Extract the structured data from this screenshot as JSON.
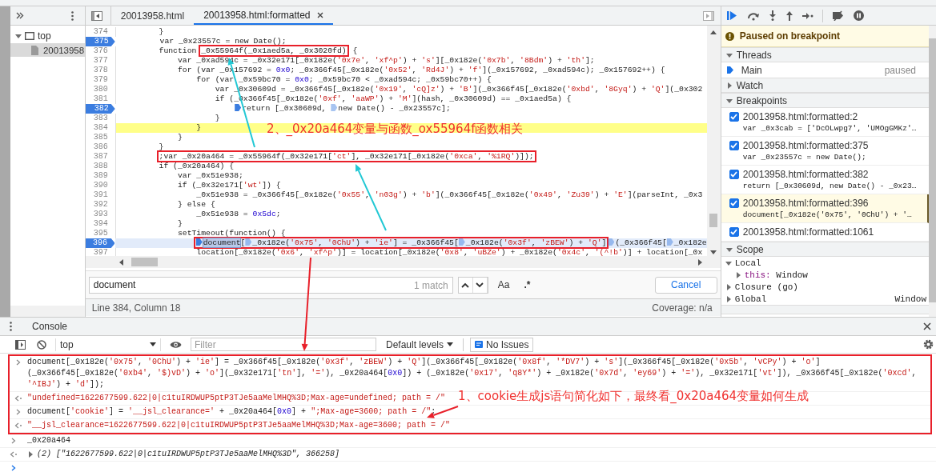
{
  "navigator": {
    "tree": [
      {
        "label": "top",
        "expanded": true,
        "children": [
          {
            "label": "20013958",
            "selected": true
          }
        ]
      }
    ]
  },
  "editor": {
    "tabs": [
      {
        "label": "20013958.html",
        "selected": false,
        "closable": false
      },
      {
        "label": "20013958.html:formatted",
        "selected": true,
        "closable": true
      }
    ],
    "lines": [
      {
        "number": "374",
        "breakpoint": false,
        "kind": "plain",
        "text": "        }"
      },
      {
        "number": "375",
        "breakpoint": true,
        "kind": "plain",
        "text": "        var _0x23557c = new Date();"
      },
      {
        "number": "376",
        "breakpoint": false,
        "kind": "plain",
        "segments": [
          {
            "text": "        function ",
            "kind": "plain",
            "match": false,
            "boxed": false
          },
          {
            "text": "_0x55964f(_0x1aed5a, _0x3020fd)",
            "kind": "plain",
            "match": false,
            "boxed": true
          },
          {
            "text": " {",
            "kind": "plain",
            "match": false,
            "boxed": false
          }
        ]
      },
      {
        "number": "377",
        "breakpoint": false,
        "kind": "plain",
        "text": "            var _0xad594c = _0x32e171[_0x182e('0x7e', 'xf^p') + 's'][_0x182e('0x7b', '8Bdm') + 'th'];"
      },
      {
        "number": "378",
        "breakpoint": false,
        "kind": "plain",
        "text": "            for (var _0x157692 = 0x0; _0x366f45[_0x182e('0x52', 'Rd4J') + 'f'](_0x157692, _0xad594c); _0x157692++) {"
      },
      {
        "number": "379",
        "breakpoint": false,
        "kind": "plain",
        "text": "                for (var _0x59bc70 = 0x0; _0x59bc70 < _0xad594c; _0x59bc70++) {"
      },
      {
        "number": "380",
        "breakpoint": false,
        "kind": "plain",
        "text": "                    var _0x30609d = _0x366f45[_0x182e('0x19', 'cQ]z') + 'B'](_0x366f45[_0x182e('0xbd', '8Gyq') + 'Q'](_0x302"
      },
      {
        "number": "381",
        "breakpoint": false,
        "kind": "plain",
        "text": "                    if (_0x366f45[_0x182e('0xf', 'aaWP') + 'M'](hash, _0x30609d) == _0x1aed5a) {"
      },
      {
        "number": "382",
        "breakpoint": true,
        "kind": "plain",
        "segments": [
          {
            "text": "                        return [_0x30609d, ",
            "kind": "active",
            "match": false,
            "boxed": false
          },
          {
            "text": "new Date() - _0x23557c];",
            "kind": "inactive",
            "match": false,
            "boxed": false
          }
        ]
      },
      {
        "number": "383",
        "breakpoint": false,
        "kind": "plain",
        "text": "                    }"
      },
      {
        "number": "384",
        "breakpoint": false,
        "kind": "revealed",
        "text": "                }"
      },
      {
        "number": "385",
        "breakpoint": false,
        "kind": "plain",
        "text": "            }"
      },
      {
        "number": "386",
        "breakpoint": false,
        "kind": "plain",
        "text": "        }"
      },
      {
        "number": "387",
        "breakpoint": false,
        "kind": "plain",
        "segments": [
          {
            "text": "        ;var _0x20a464 = _0x55964f(_0x32e171['ct'], _0x32e171[_0x182e('0xca', '%1RQ')]);",
            "kind": "plain",
            "match": false,
            "boxed": true
          }
        ]
      },
      {
        "number": "388",
        "breakpoint": false,
        "kind": "plain",
        "text": "        if (_0x20a464) {"
      },
      {
        "number": "389",
        "breakpoint": false,
        "kind": "plain",
        "text": "            var _0x51e938;"
      },
      {
        "number": "390",
        "breakpoint": false,
        "kind": "plain",
        "text": "            if (_0x32e171['wt']) {"
      },
      {
        "number": "391",
        "breakpoint": false,
        "kind": "plain",
        "text": "                _0x51e938 = _0x366f45[_0x182e('0x55', 'n03g') + 'b'](_0x366f45[_0x182e('0x49', 'Zu39') + 'E'](parseInt, _0x3"
      },
      {
        "number": "392",
        "breakpoint": false,
        "kind": "plain",
        "text": "            } else {"
      },
      {
        "number": "393",
        "breakpoint": false,
        "kind": "plain",
        "text": "                _0x51e938 = 0x5dc;"
      },
      {
        "number": "394",
        "breakpoint": false,
        "kind": "plain",
        "text": "            }"
      },
      {
        "number": "395",
        "breakpoint": false,
        "kind": "plain",
        "text": "            setTimeout(function() {"
      },
      {
        "number": "396",
        "breakpoint": true,
        "kind": "execution",
        "segments": [
          {
            "text": "                document",
            "kind": "active",
            "match": true,
            "boxed": true
          },
          {
            "text": "[",
            "kind": "plain",
            "match": false,
            "boxed": true
          },
          {
            "text": "_0x182e('0x75', '0ChU') + 'ie'] = _0x366f45[",
            "kind": "inactive",
            "match": false,
            "boxed": true
          },
          {
            "text": "_0x182e('0x3f', 'zBEW') + 'Q']",
            "kind": "inactive",
            "match": false,
            "boxed": true
          },
          {
            "text": "(_0x366f45[",
            "kind": "inactive",
            "match": false,
            "boxed": false
          },
          {
            "text": "_0x182e",
            "kind": "inactive",
            "match": false,
            "boxed": false
          }
        ]
      },
      {
        "number": "397",
        "breakpoint": false,
        "kind": "plain",
        "text": "                location[_0x182e('0x6', 'xf^p')] = location[_0x182e('0x8', 'uBZe') + _0x182e('0x4c', '(^!b')] + location[_0x"
      }
    ],
    "search": {
      "value": "document",
      "matches": "1 match",
      "case_label": "Aa",
      "regex_label": ".*",
      "cancel": "Cancel"
    },
    "status": {
      "position": "Line 384, Column 18",
      "coverage": "Coverage: n/a"
    }
  },
  "debugger": {
    "paused_message": "Paused on breakpoint",
    "sections": [
      {
        "kind": "threads",
        "title": "Threads",
        "expanded": true,
        "threads": [
          {
            "name": "Main",
            "state": "paused"
          }
        ]
      },
      {
        "kind": "watch",
        "title": "Watch",
        "expanded": false
      },
      {
        "kind": "breakpoints",
        "title": "Breakpoints",
        "expanded": true,
        "items": [
          {
            "location": "20013958.html:formatted:2",
            "code": "var _0x3cab = ['DcOLwpg7', 'UMOgGMKz'…",
            "checked": true,
            "selected": false
          },
          {
            "location": "20013958.html:formatted:375",
            "code": "var _0x23557c = new Date();",
            "checked": true,
            "selected": false
          },
          {
            "location": "20013958.html:formatted:382",
            "code": "return [_0x30609d, new Date() - _0x23…",
            "checked": true,
            "selected": false
          },
          {
            "location": "20013958.html:formatted:396",
            "code": "document[_0x182e('0x75', '0ChU') + '…",
            "checked": true,
            "selected": true
          },
          {
            "location": "20013958.html:formatted:1061",
            "checked": true,
            "selected": false
          }
        ]
      },
      {
        "kind": "scope",
        "title": "Scope",
        "expanded": true,
        "items": [
          {
            "name": "Local",
            "expanded": true,
            "children": [
              {
                "name": "this:",
                "value": "Window",
                "expanded": false
              }
            ]
          },
          {
            "name": "Closure (go)",
            "expanded": false
          },
          {
            "name": "Global",
            "value": "Window",
            "expanded": false
          }
        ]
      }
    ]
  },
  "console": {
    "tab": "Console",
    "context": "top",
    "filter_placeholder": "Filter",
    "levels": "Default levels",
    "issues": "No Issues",
    "entries": [
      {
        "kind": "input",
        "boxed": true,
        "text": "document[_0x182e('0x75', '0ChU') + 'ie'] = _0x366f45[_0x182e('0x3f', 'zBEW') + 'Q'](_0x366f45[_0x182e('0x8f', '*DV7') + 's'](_0x366f45[_0x182e('0x5b', 'vCPy') + 'o'] (_0x366f45[_0x182e('0xb4', '$)vD') + 'o'](_0x32e171['tn'], '='), _0x20a464[0x0]) + (_0x182e('0x17', 'q8Y*') + _0x182e('0x7d', 'ey69') + '='), _0x32e171['vt']), _0x366f45[_0x182e('0xcd', '^IBJ') + 'd']);"
      },
      {
        "kind": "result",
        "boxed": true,
        "text": "\"undefined=1622677599.622|0|c1tuIRDWUP5ptP3TJe5aaMelMHQ%3D;Max-age=undefined; path = /\""
      },
      {
        "kind": "input",
        "boxed": true,
        "text": "document['cookie'] = '__jsl_clearance=' + _0x20a464[0x0] + \";Max-age=3600; path = /\";"
      },
      {
        "kind": "result",
        "boxed": true,
        "text": "\"__jsl_clearance=1622677599.622|0|c1tuIRDWUP5ptP3TJe5aaMelMHQ%3D;Max-age=3600; path = /\""
      },
      {
        "kind": "input",
        "boxed": false,
        "text": "_0x20a464"
      },
      {
        "kind": "object",
        "boxed": false,
        "text": "(2) [\"1622677599.622|0|c1tuIRDWUP5ptP3TJe5aaMelMHQ%3D\", 366258]"
      },
      {
        "kind": "prompt",
        "boxed": false
      }
    ]
  },
  "annotations": [
    {
      "text": "2、_0x20a464变量与函数_ox55964f函数相关"
    },
    {
      "text": "1、cookie生成js语句简化如下，最终看_0x20a464变量如何生成"
    }
  ]
}
